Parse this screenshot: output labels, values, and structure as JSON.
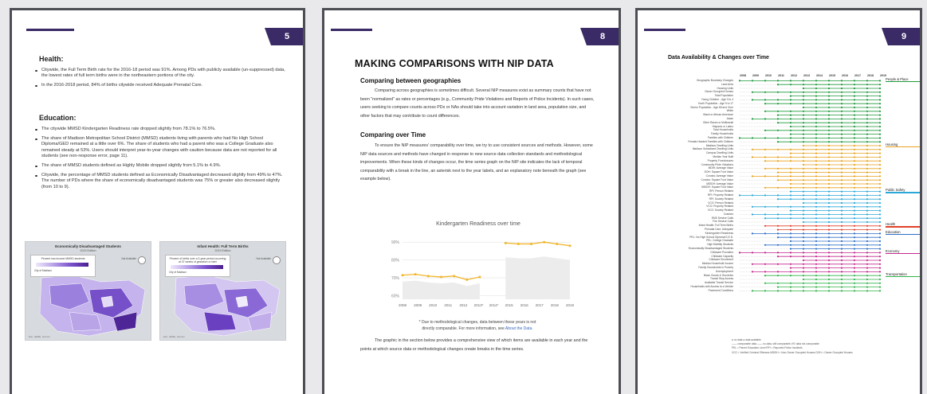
{
  "pages": [
    {
      "number": "5",
      "health": {
        "heading": "Health:",
        "bullets": [
          "Citywide, the Full Term Birth rate for the 2016-18 period was 91%. Among PDs with publicly available (un-suppressed) data, the lowest rates of full term births were in the northeastern portions of the city.",
          "In the 2016-2018 period, 84% of births citywide received Adequate Prenatal Care."
        ]
      },
      "education": {
        "heading": "Education:",
        "bullets": [
          "The citywide MMSD Kindergarten Readiness rate dropped slightly from 78.1% to 76.5%.",
          "The share of Madison Metropolitan School District (MMSD) students living with parents who had No High School Diploma/GED remained at a little over 6%. The share of students who had a parent who was a College Graduate also remained steady at 53%. Users should interpret year-to-year changes with caution because data are not reported for all students (see non-response error, page 11).",
          "The share of MMSD students defined as Highly Mobile dropped slightly from 5.1% to 4.9%.",
          "Citywide, the percentage of MMSD students defined as Economically Disadvantaged decreased slightly from 49% to 47%. The number of PDs where the share of economically disadvantaged students was 75% or greater also decreased slightly (from 10 to 9)."
        ]
      },
      "maps": [
        {
          "title": "Economically Disadvantaged Students",
          "subtitle": "2019 Edition",
          "legend_caption": "Percent low-income MMSD students",
          "legend_low": "City of Madison",
          "legend_cb": "Not Available",
          "zoom_label": "Not Available",
          "credit": "Esri, HERE, Garmin"
        },
        {
          "title": "Infant Health: Full Term Births",
          "subtitle": "2019 Edition",
          "legend_caption": "Percent of births over a 3-year period occurring at 37 weeks of gestation or later",
          "legend_low": "City of Madison",
          "legend_cb": "Not Available",
          "zoom_label": "Not Available",
          "credit": "Esri, HERE, Garmin"
        }
      ]
    },
    {
      "number": "8",
      "title": "MAKING COMPARISONS WITH NIP DATA",
      "sec1_heading": "Comparing between geographies",
      "sec1_text": "Comparing across geographies is sometimes difficult. Several NIP measures exist as summary counts that have not been \"normalized\" as rates or percentages (e.g., Community Pride Violations and Reports of Police Incidents). In such cases, users seeking to compare counts across PDs or NAs should take into account variation in land area, population size, and other factors that may contribute to count differences.",
      "sec2_heading": "Comparing over Time",
      "sec2_text": "To ensure the NIP measures' comparability over time, we try to use consistent sources and methods. However, some NIP data sources and methods have changed in response to new source data collection standards and methodological improvements. When these kinds of changes occur, the time series graph on the NIP site indicates the lack of temporal comparability with a break in the line, an asterisk next to the year labels, and an explanatory note beneath the graph (see example below).",
      "chart_note_1": "* Due to methodological changes, data between these years is not",
      "chart_note_2": "directly comparable. For more information, see",
      "chart_note_link": "About the Data.",
      "closing_text": "The graphic in the section below provides a comprehensive view of which items are available in each year and the points at which source data or methodological changes create breaks in the time series."
    },
    {
      "number": "9",
      "title": "Data Availability & Changes over Time",
      "years": [
        "2008",
        "2009",
        "2010",
        "2011",
        "2012",
        "2013",
        "2014",
        "2015",
        "2016",
        "2017",
        "2018",
        "2019"
      ],
      "indicators": [
        "Geographic Boundary Changes",
        "Land Area",
        "Housing Units",
        "Owner Occupied Homes",
        "Total Population",
        "Young Children - Age 0 to 4",
        "Youth Population - Age 5 to 17",
        "Senior Population - Age 65 and Over",
        "White",
        "Black or African American",
        "Asian",
        "Other Races or Multiracial",
        "Hispanic or Latino",
        "Total Households",
        "Family Households",
        "Families with Children",
        "Female-Headed Families with Children",
        "Madison Dwelling Units",
        "Madison Subsidized Dwelling Units",
        "Campus Dwelling Units",
        "Median Year Built",
        "Property Foreclosures",
        "Community Pride Violations",
        "MDIH: Average Value",
        "DOH: Square Foot Value",
        "Condos: Average Value",
        "Condos: Square Foot Value",
        "MDIDH: Average Value",
        "MDIDH: Square Foot Value",
        "RPI: Person Related",
        "RPI: Property Related",
        "RPI: Society Related",
        "VCO: Person Related",
        "VCO: Property Related",
        "VCO: Society Related",
        "Crashes",
        "EMS Service Calls",
        "Fire Service Calls",
        "Infant Health: Full Term Births",
        "Prenatal Care: Adequate",
        "Kindergarten Readiness",
        "PEL: No High School Diploma/G.E.D.",
        "PEL: College Graduate",
        "High Mobility Students",
        "Economically Disadvantaged Students",
        "Childcare Providers",
        "Childcare Capacity",
        "Childcare Enrollment",
        "Median Household Income",
        "Family Households in Poverty",
        "Unemployment",
        "Basic Goods & Groceries",
        "Transit Stop Access",
        "Available Transit Service",
        "Households with Access to a Vehicle",
        "Pavement Conditions"
      ],
      "categories": [
        {
          "label": "People & Place",
          "color": "#1f9a3c"
        },
        {
          "label": "Housing",
          "color": "#e8a21b"
        },
        {
          "label": "Public Safety",
          "color": "#2aa8d8"
        },
        {
          "label": "Health",
          "color": "#e0402a"
        },
        {
          "label": "Education",
          "color": "#2f6fc8"
        },
        {
          "label": "Economy",
          "color": "#c4288f"
        },
        {
          "label": "Transportation",
          "color": "#33b34a"
        }
      ],
      "legend_line1": "● no data   ● data available",
      "legend_line2": "—— comparable data   —— no data, still comparable   ////// data not comparable",
      "legend_line3": "PEL = Parent Education Level   RPI = Reported Police Incidents",
      "legend_line4": "VCO = Verified Criminal Offenses   MDIDH = Non-Owner Occupied Houses   DOH = Owner Occupied Houses"
    }
  ],
  "chart_data": {
    "type": "line",
    "title": "Kindergarten Readiness over time",
    "x": [
      "2008",
      "2009",
      "2010",
      "2011",
      "2012",
      "2013*",
      "2014*",
      "2015",
      "2016",
      "2017",
      "2018",
      "2019"
    ],
    "series": [
      {
        "values": [
          71.5,
          72,
          71,
          70.5,
          71,
          69,
          70.5,
          null,
          89.5,
          89,
          89,
          90,
          89,
          88
        ]
      }
    ],
    "xticks": [
      "2008",
      "2009",
      "2010",
      "2011",
      "2012",
      "2013*",
      "2014*",
      "2015",
      "2016",
      "2017",
      "2018",
      "2019"
    ],
    "yticks": [
      "60%",
      "70%",
      "80%",
      "90%"
    ],
    "ylim": [
      58,
      95
    ],
    "color": "#f0b62a",
    "break_between": [
      "2013*",
      "2014*"
    ]
  }
}
